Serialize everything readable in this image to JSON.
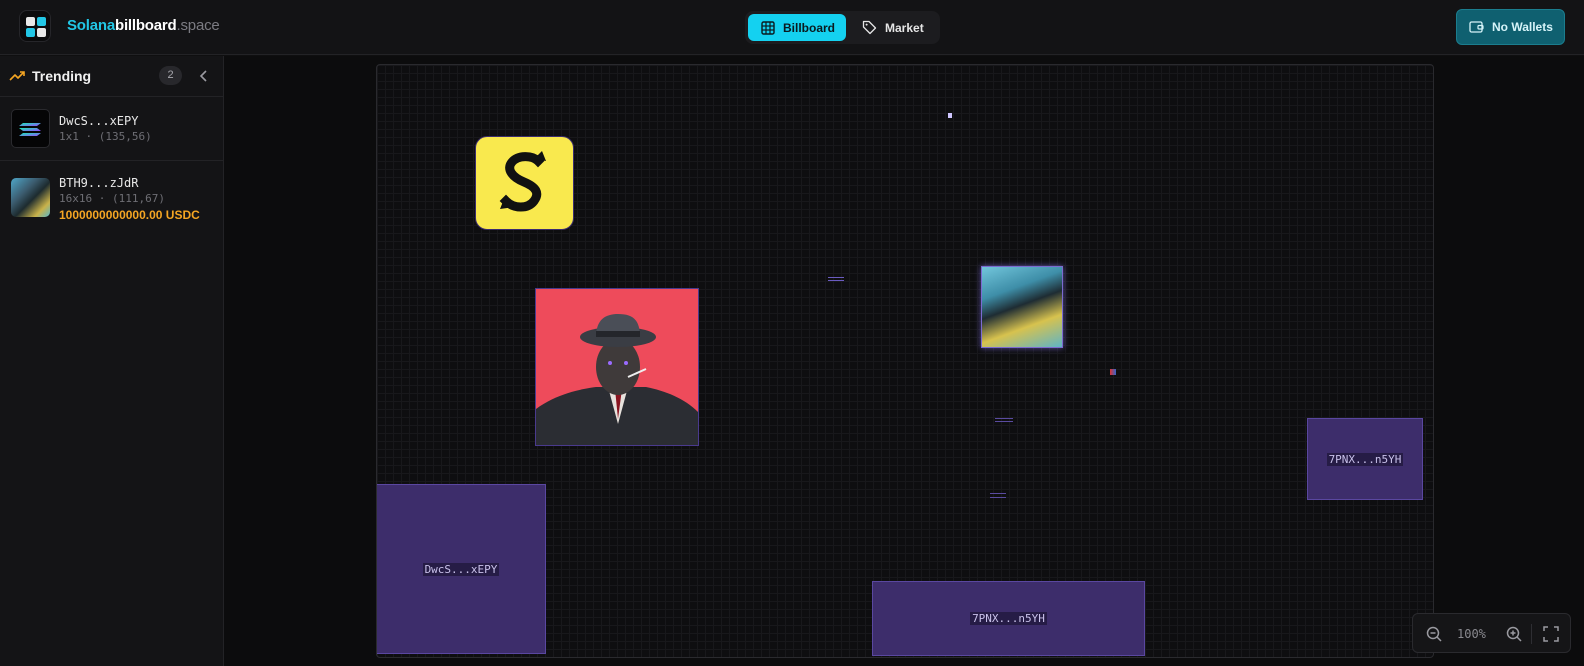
{
  "header": {
    "brand_part1": "Solana",
    "brand_part2": "billboard",
    "brand_part3": ".space",
    "tabs": [
      {
        "label": "Billboard",
        "icon": "grid-icon",
        "active": true
      },
      {
        "label": "Market",
        "icon": "tag-icon",
        "active": false
      }
    ],
    "wallet_label": "No Wallets",
    "wallet_icon": "wallet-icon"
  },
  "sidebar": {
    "title": "Trending",
    "title_icon": "trending-up-icon",
    "count": "2",
    "collapse_icon": "chevron-left-icon",
    "items": [
      {
        "name": "DwcS...xEPY",
        "meta": "1x1 · (135,56)",
        "price": ""
      },
      {
        "name": "BTH9...zJdR",
        "meta": "16x16 · (111,67)",
        "price": "1000000000000.00 USDC"
      }
    ]
  },
  "board": {
    "labels": [
      {
        "text": "DwcS...xEPY"
      },
      {
        "text": "7PNX...n5YH"
      },
      {
        "text": "7PNX...n5YH"
      }
    ]
  },
  "zoom": {
    "value": "100%",
    "zoom_out_icon": "zoom-out-icon",
    "zoom_in_icon": "zoom-in-icon",
    "fullscreen_icon": "fullscreen-icon"
  },
  "colors": {
    "accent": "#14d1f0",
    "wallet": "#0f6070",
    "price": "#f5a623",
    "tile_purple": "#3d2d6b"
  }
}
